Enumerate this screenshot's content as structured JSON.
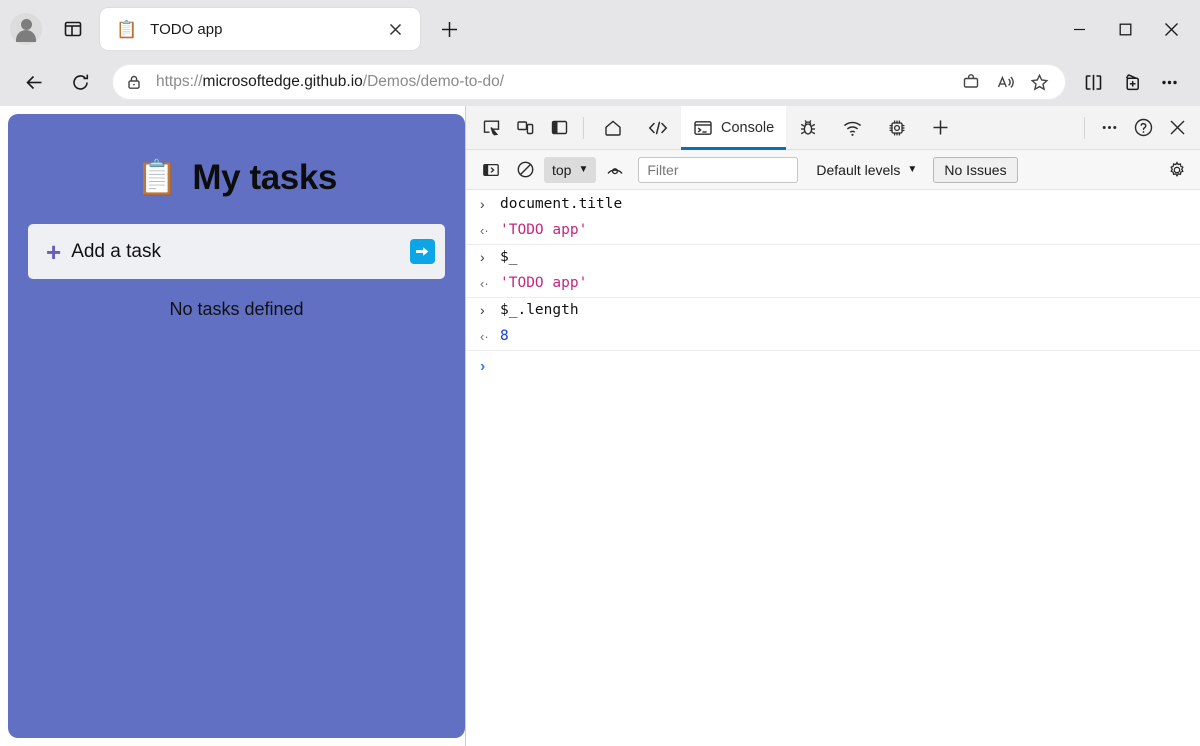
{
  "browser": {
    "profile_icon": "avatar-icon",
    "tab_actions_icon": "tab-actions-icon",
    "tabs": [
      {
        "favicon": "📋",
        "title": "TODO app",
        "close_label": "×"
      }
    ],
    "new_tab_label": "+",
    "window_controls": {
      "minimize": "—",
      "maximize": "☐",
      "close": "✕"
    },
    "nav": {
      "back_icon": "back-arrow-icon",
      "refresh_icon": "refresh-icon",
      "lock_icon": "lock-icon",
      "url_prefix": "https://",
      "url_host": "microsoftedge.github.io",
      "url_path": "/Demos/demo-to-do/",
      "url_full": "https://microsoftedge.github.io/Demos/demo-to-do/",
      "omnibox_actions": [
        "shopping-icon",
        "read-aloud-icon",
        "favorite-star-icon"
      ],
      "trailing_actions": [
        "split-screen-icon",
        "collections-icon",
        "settings-more-icon"
      ]
    }
  },
  "page": {
    "emoji": "📋",
    "title": "My tasks",
    "add_task_plus": "+",
    "add_task_placeholder": "Add a task",
    "submit_arrow": "➡",
    "empty_message": "No tasks defined",
    "background_color": "#6270c4",
    "input_background": "#eff0f4",
    "submit_color": "#0ca6e8"
  },
  "devtools": {
    "left_tools": [
      "inspect-element-icon",
      "device-emulation-icon",
      "toggle-sidebar-icon"
    ],
    "tabs": [
      {
        "id": "welcome",
        "icon": "home-icon",
        "label": "",
        "active": false
      },
      {
        "id": "elements",
        "icon": "elements-icon",
        "label": "",
        "active": false
      },
      {
        "id": "console",
        "icon": "console-icon",
        "label": "Console",
        "active": true
      },
      {
        "id": "sources",
        "icon": "bug-icon",
        "label": "",
        "active": false
      },
      {
        "id": "network",
        "icon": "network-wifi-icon",
        "label": "",
        "active": false
      },
      {
        "id": "performance",
        "icon": "chip-icon",
        "label": "",
        "active": false
      },
      {
        "id": "more-tools",
        "icon": "plus-icon",
        "label": "",
        "active": false
      }
    ],
    "right_actions": [
      "more-options-icon",
      "help-icon",
      "close-devtools-icon"
    ],
    "filterbar": {
      "sidebar_icon": "console-sidebar-icon",
      "clear_icon": "clear-console-icon",
      "context": "top",
      "context_chevron": "▼",
      "live_expression_icon": "eye-icon",
      "filter_placeholder": "Filter",
      "filter_value": "",
      "levels_label": "Default levels",
      "levels_chevron": "▼",
      "issues_label": "No Issues",
      "settings_icon": "gear-icon"
    },
    "console": {
      "input_marker": "›",
      "output_marker": "‹·",
      "prompt_marker": "›",
      "entries": [
        {
          "input": "document.title",
          "output": "'TODO app'",
          "output_type": "string"
        },
        {
          "input": "$_",
          "output": "'TODO app'",
          "output_type": "string"
        },
        {
          "input": "$_.length",
          "output": "8",
          "output_type": "number"
        }
      ]
    }
  }
}
